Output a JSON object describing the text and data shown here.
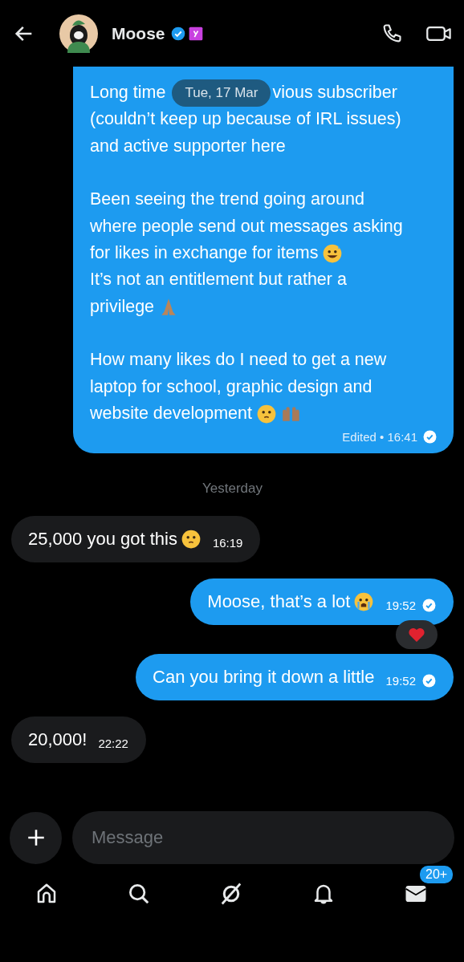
{
  "header": {
    "name": "Moose",
    "verified": true,
    "affiliate": true
  },
  "date_chip": "Tue, 17 Mar",
  "first_message": {
    "paragraphs": [
      [
        {
          "text": "Long time",
          "text_after": "vious subscriber"
        },
        {
          "text": "(couldn’t keep up because of IRL issues)"
        },
        {
          "text": "and active supporter here"
        }
      ],
      [
        {
          "text": "Been seeing the trend going around"
        },
        {
          "text": "where people send out messages asking"
        },
        {
          "text": "for likes in exchange for items",
          "emoji": [
            {
              "kind": "sweat-smile"
            }
          ]
        },
        {
          "text": "It’s not an entitlement but rather a"
        },
        {
          "text": "privilege",
          "emoji": [
            {
              "kind": "pray"
            }
          ]
        }
      ],
      [
        {
          "text": "How many likes do I need to get a new"
        },
        {
          "text": "laptop for school, graphic design and"
        },
        {
          "text": "website development",
          "emoji": [
            {
              "kind": "pleading"
            },
            {
              "kind": "palms"
            }
          ]
        }
      ]
    ],
    "meta": "Edited • 16:41",
    "seen": true
  },
  "day_separator": "Yesterday",
  "messages": [
    {
      "kind": "received",
      "text": "25,000 you got this",
      "emoji": [
        {
          "kind": "pleading"
        }
      ],
      "time": "16:19"
    },
    {
      "kind": "sent",
      "text": "Moose, that’s a lot",
      "emoji": [
        {
          "kind": "crying"
        }
      ],
      "time": "19:52",
      "seen": true,
      "reaction": {
        "kind": "heart"
      }
    },
    {
      "kind": "sent",
      "text": "Can you bring it down a little",
      "time": "19:52",
      "seen": true
    },
    {
      "kind": "received",
      "text": "20,000!",
      "time": "22:22"
    }
  ],
  "composer": {
    "placeholder": "Message"
  },
  "nav": [
    {
      "kind": "home"
    },
    {
      "kind": "search"
    },
    {
      "kind": "grok"
    },
    {
      "kind": "bell"
    },
    {
      "kind": "mail",
      "badge": "20+"
    }
  ]
}
